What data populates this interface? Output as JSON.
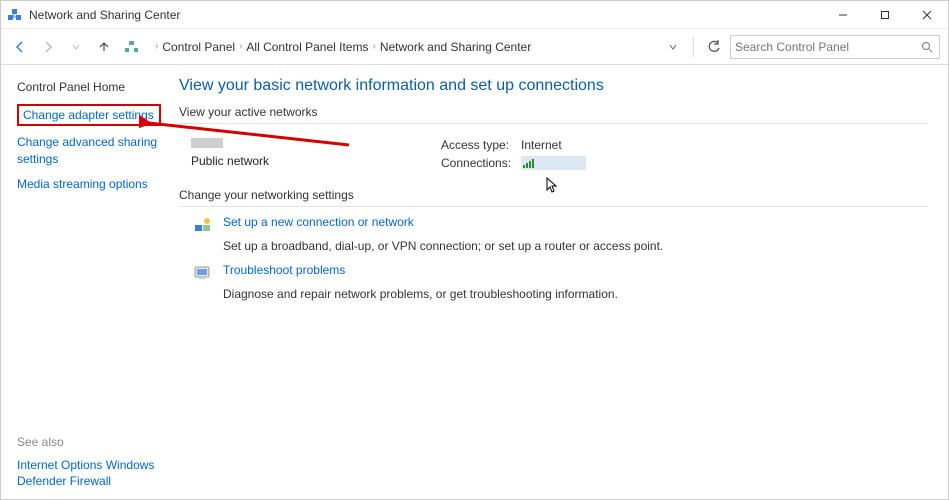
{
  "window": {
    "title": "Network and Sharing Center"
  },
  "breadcrumb": {
    "cp": "Control Panel",
    "all": "All Control Panel Items",
    "current": "Network and Sharing Center"
  },
  "search": {
    "placeholder": "Search Control Panel"
  },
  "sidebar": {
    "home": "Control Panel Home",
    "adapter": "Change adapter settings",
    "advanced": "Change advanced sharing settings",
    "media": "Media streaming options",
    "seealso_title": "See also",
    "internet_options": "Internet Options",
    "firewall": "Windows Defender Firewall"
  },
  "main": {
    "title": "View your basic network information and set up connections",
    "active_label": "View your active networks",
    "network_type": "Public network",
    "access_label": "Access type:",
    "access_value": "Internet",
    "connections_label": "Connections:",
    "change_label": "Change your networking settings",
    "setup_title": "Set up a new connection or network",
    "setup_desc": "Set up a broadband, dial-up, or VPN connection; or set up a router or access point.",
    "trouble_title": "Troubleshoot problems",
    "trouble_desc": "Diagnose and repair network problems, or get troubleshooting information."
  }
}
